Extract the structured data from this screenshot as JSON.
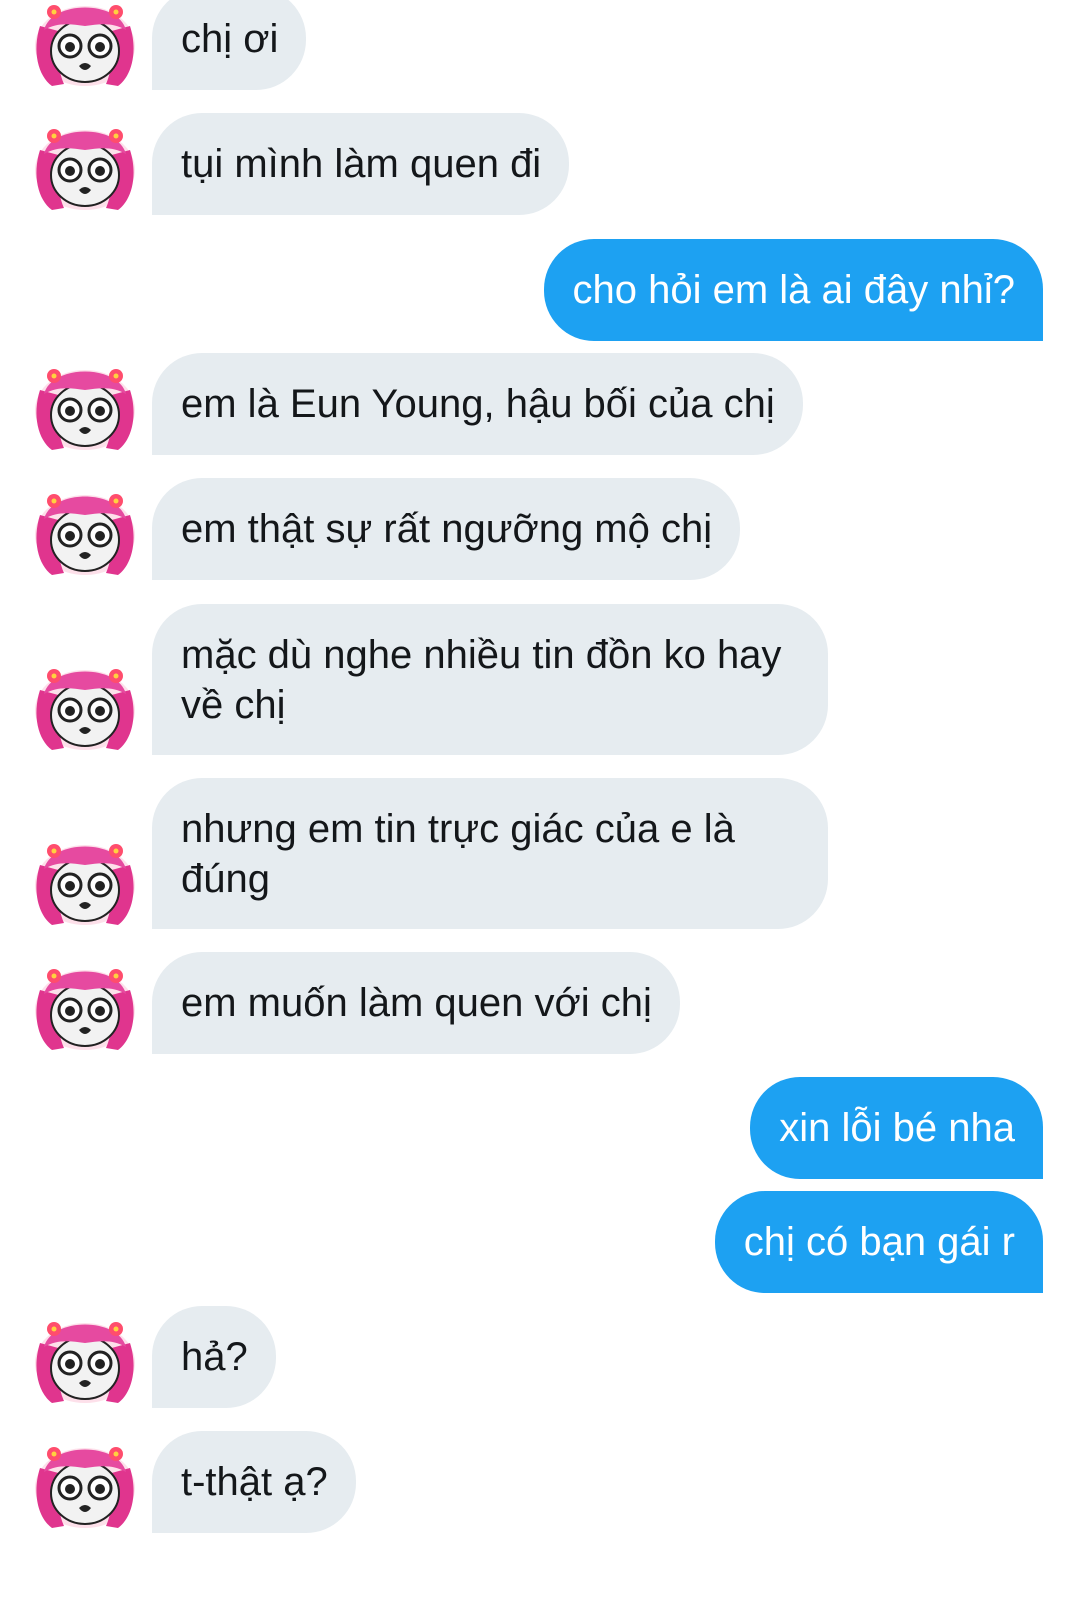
{
  "conversation": {
    "messages": [
      {
        "sender": "other",
        "text": "chị ơi"
      },
      {
        "sender": "other",
        "text": "tụi mình làm quen đi"
      },
      {
        "sender": "me",
        "text": "cho hỏi em là ai đây nhỉ?"
      },
      {
        "sender": "other",
        "text": "em là Eun Young, hậu bối của chị"
      },
      {
        "sender": "other",
        "text": "em thật sự rất ngưỡng mộ chị"
      },
      {
        "sender": "other",
        "text": "mặc dù nghe nhiều tin đồn ko hay về chị"
      },
      {
        "sender": "other",
        "text": "nhưng em tin trực giác của e là đúng"
      },
      {
        "sender": "other",
        "text": "em muốn làm quen với chị"
      },
      {
        "sender": "me",
        "text": "xin lỗi bé nha"
      },
      {
        "sender": "me",
        "text": "chị có bạn gái r"
      },
      {
        "sender": "other",
        "text": "hả?"
      },
      {
        "sender": "other",
        "text": "t-thật ạ?"
      }
    ]
  },
  "theme": {
    "incoming_bubble_color": "#e6ecf0",
    "outgoing_bubble_color": "#1da1f2",
    "incoming_text_color": "#14171a",
    "outgoing_text_color": "#ffffff",
    "avatar_icon": "pink-haired-girl-avatar-icon"
  }
}
